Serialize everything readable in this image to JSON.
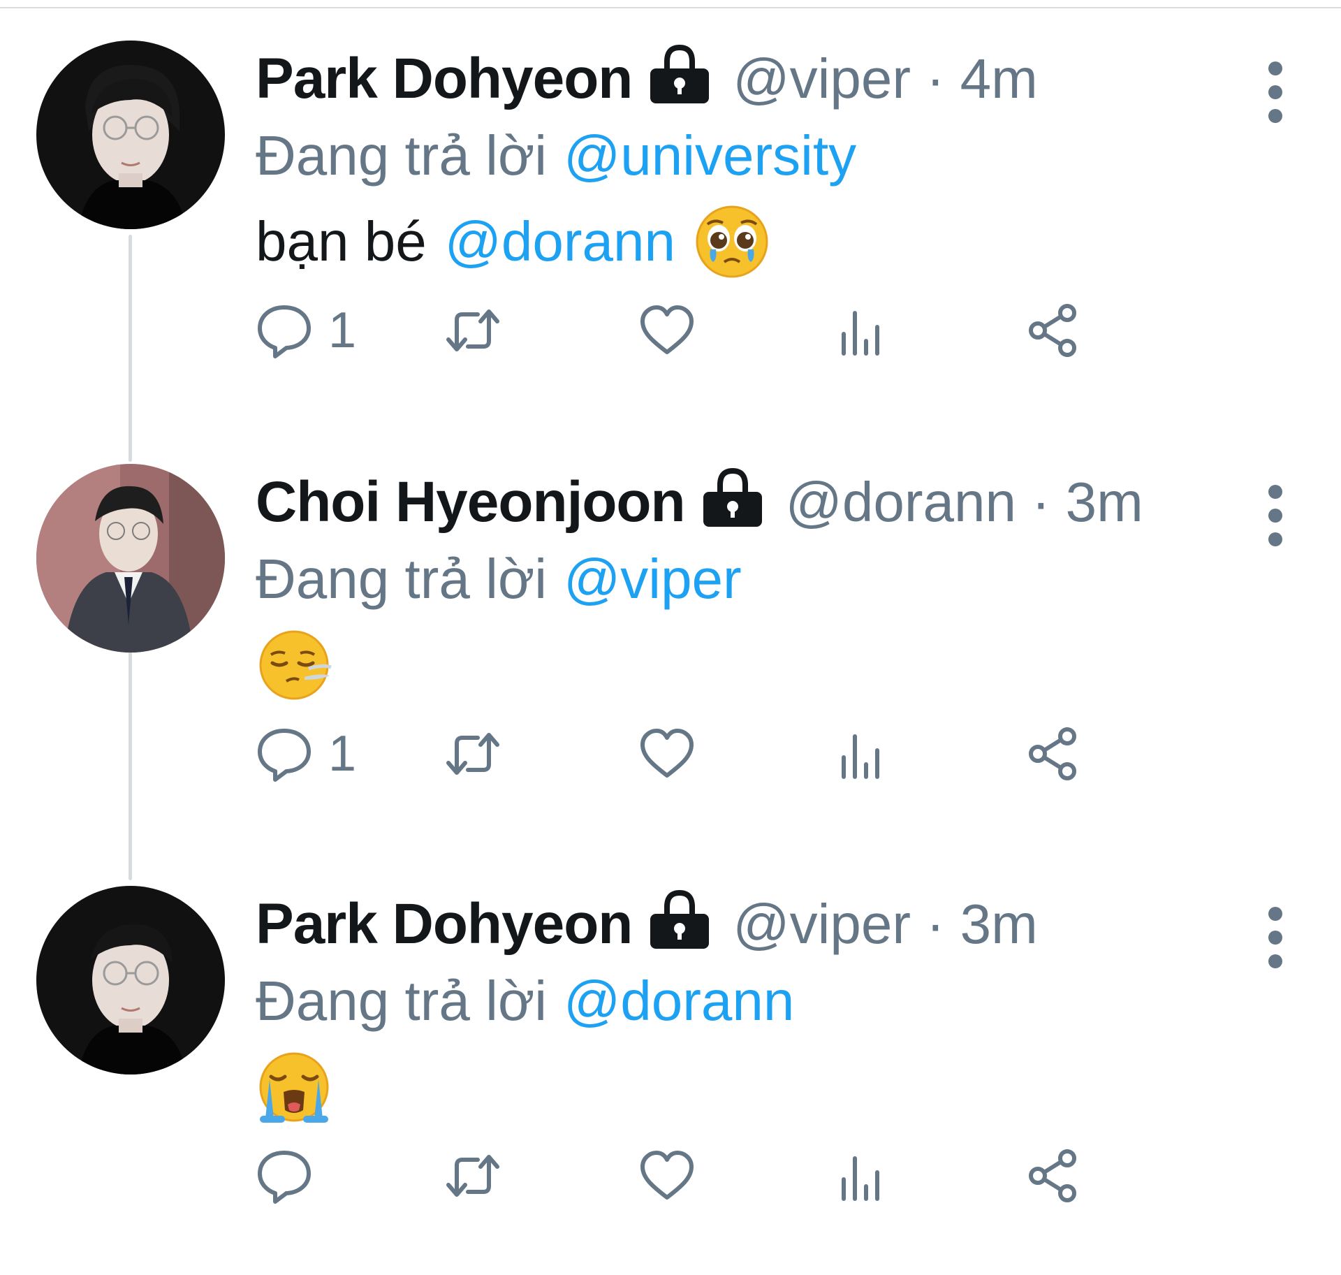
{
  "tweets": [
    {
      "name": "Park Dohyeon",
      "handle": "@viper",
      "dot": "·",
      "time": "4m",
      "reply_prefix": "Đang trả lời",
      "reply_to": "@university",
      "text": "bạn bé",
      "text_mention": "@dorann",
      "emoji": "pleading-face",
      "reply_count": "1"
    },
    {
      "name": "Choi Hyeonjoon",
      "handle": "@dorann",
      "dot": "·",
      "time": "3m",
      "reply_prefix": "Đang trả lời",
      "reply_to": "@viper",
      "emoji": "face-exhaling",
      "reply_count": "1"
    },
    {
      "name": "Park Dohyeon",
      "handle": "@viper",
      "dot": "·",
      "time": "3m",
      "reply_prefix": "Đang trả lời",
      "reply_to": "@dorann",
      "emoji": "loudly-crying-face",
      "reply_count": ""
    }
  ],
  "icons": {
    "protected": "lock-icon",
    "more": "more-options-icon",
    "reply": "reply-icon",
    "retweet": "retweet-icon",
    "like": "heart-icon",
    "analytics": "analytics-icon",
    "share": "share-icon"
  },
  "colors": {
    "text": "#14171a",
    "secondary": "#657786",
    "link": "#1da1f2",
    "thread_line": "#d6dbe0"
  }
}
